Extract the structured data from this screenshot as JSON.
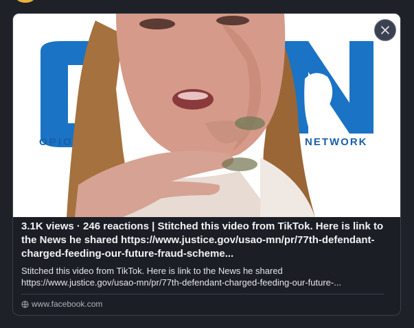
{
  "post": {
    "headline": "3.1K views · 246 reactions | Stitched this video from TikTok. Here is link to the News he shared https://www.justice.gov/usao-mn/pr/77th-defendant-charged-feeding-our-future-fraud-scheme...",
    "description_line1": "Stitched this video from TikTok. Here is link to the News he shared",
    "description_line2": "https://www.justice.gov/usao-mn/pr/77th-defendant-charged-feeding-our-future-...",
    "source": "www.facebook.com"
  },
  "media": {
    "background_logo_text_left": "OPIOI",
    "background_logo_text_right": "NETWORK",
    "brand_blue": "#1a73c4"
  },
  "icons": {
    "close": "close-icon",
    "globe": "globe-icon"
  }
}
